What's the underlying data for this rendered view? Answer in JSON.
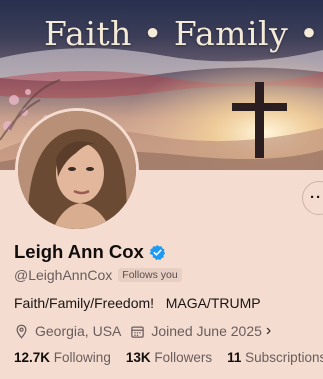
{
  "banner": {
    "title": "Faith • Family •"
  },
  "profile": {
    "name": "Leigh Ann Cox",
    "handle": "@LeighAnnCox",
    "follows_you": "Follows you",
    "bio": "Faith/Family/Freedom!   MAGA/TRUMP",
    "location": "Georgia, USA",
    "joined": "Joined June 2025",
    "verified_color": "#1d9bf0"
  },
  "stats": {
    "following_count": "12.7K",
    "following_label": "Following",
    "followers_count": "13K",
    "followers_label": "Followers",
    "subscriptions_count": "11",
    "subscriptions_label": "Subscriptions"
  },
  "icons": [
    "more-icon",
    "verified-icon",
    "location-icon",
    "calendar-icon",
    "chevron-right-icon"
  ]
}
